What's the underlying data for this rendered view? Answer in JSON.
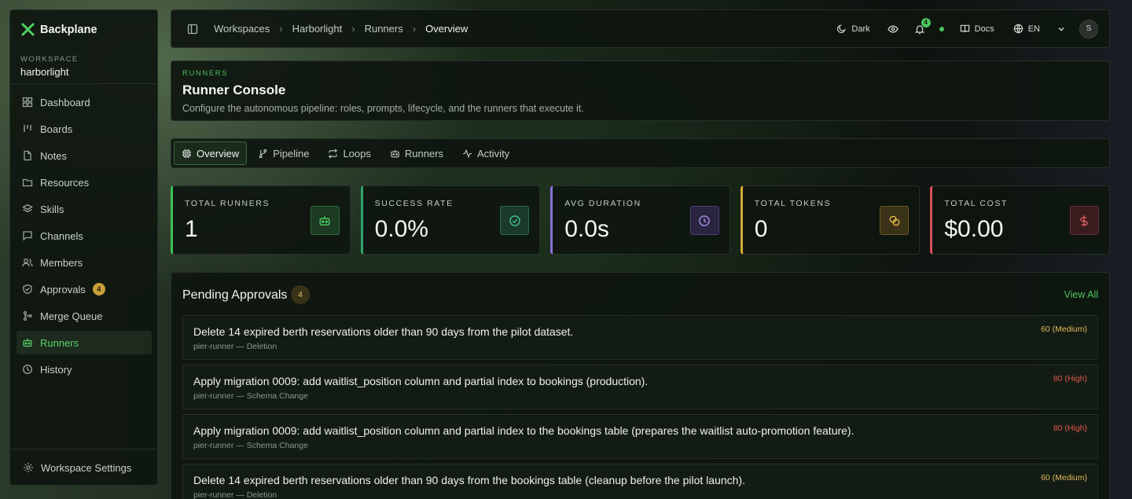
{
  "sidebar": {
    "brand": "Backplane",
    "workspace_label": "WORKSPACE",
    "workspace_name": "harborlight",
    "items": [
      {
        "label": "Dashboard"
      },
      {
        "label": "Boards"
      },
      {
        "label": "Notes"
      },
      {
        "label": "Resources"
      },
      {
        "label": "Skills"
      },
      {
        "label": "Channels"
      },
      {
        "label": "Members"
      },
      {
        "label": "Approvals",
        "badge": "4"
      },
      {
        "label": "Merge Queue"
      },
      {
        "label": "Runners",
        "active": true
      },
      {
        "label": "History"
      }
    ],
    "footer_label": "Workspace Settings"
  },
  "topbar": {
    "breadcrumb": [
      "Workspaces",
      "Harborlight",
      "Runners",
      "Overview"
    ],
    "theme_label": "Dark",
    "notification_count": "4",
    "docs_label": "Docs",
    "language": "EN",
    "avatar_initial": "S"
  },
  "header": {
    "eyebrow": "RUNNERS",
    "title": "Runner Console",
    "subtitle": "Configure the autonomous pipeline: roles, prompts, lifecycle, and the runners that execute it."
  },
  "tabs": [
    {
      "label": "Overview",
      "active": true
    },
    {
      "label": "Pipeline"
    },
    {
      "label": "Loops"
    },
    {
      "label": "Runners"
    },
    {
      "label": "Activity"
    }
  ],
  "stats": [
    {
      "label": "TOTAL RUNNERS",
      "value": "1",
      "color": "#3fbf55"
    },
    {
      "label": "SUCCESS RATE",
      "value": "0.0%",
      "color": "#2fa36f"
    },
    {
      "label": "AVG DURATION",
      "value": "0.0s",
      "color": "#8a6fd6"
    },
    {
      "label": "TOTAL TOKENS",
      "value": "0",
      "color": "#d6a83a"
    },
    {
      "label": "TOTAL COST",
      "value": "$0.00",
      "color": "#d6505a"
    }
  ],
  "approvals": {
    "title": "Pending Approvals",
    "count": "4",
    "view_all": "View All",
    "items": [
      {
        "description": "Delete 14 expired berth reservations older than 90 days from the pilot dataset.",
        "meta": "pier-runner — Deletion",
        "risk": "60 (Medium)",
        "risk_color": "#e2b85a"
      },
      {
        "description": "Apply migration 0009: add waitlist_position column and partial index to bookings (production).",
        "meta": "pier-runner — Schema Change",
        "risk": "80 (High)",
        "risk_color": "#e0574f"
      },
      {
        "description": "Apply migration 0009: add waitlist_position column and partial index to the bookings table (prepares the waitlist auto-promotion feature).",
        "meta": "pier-runner — Schema Change",
        "risk": "80 (High)",
        "risk_color": "#e0574f"
      },
      {
        "description": "Delete 14 expired berth reservations older than 90 days from the bookings table (cleanup before the pilot launch).",
        "meta": "pier-runner — Deletion",
        "risk": "60 (Medium)",
        "risk_color": "#e2b85a"
      }
    ]
  }
}
